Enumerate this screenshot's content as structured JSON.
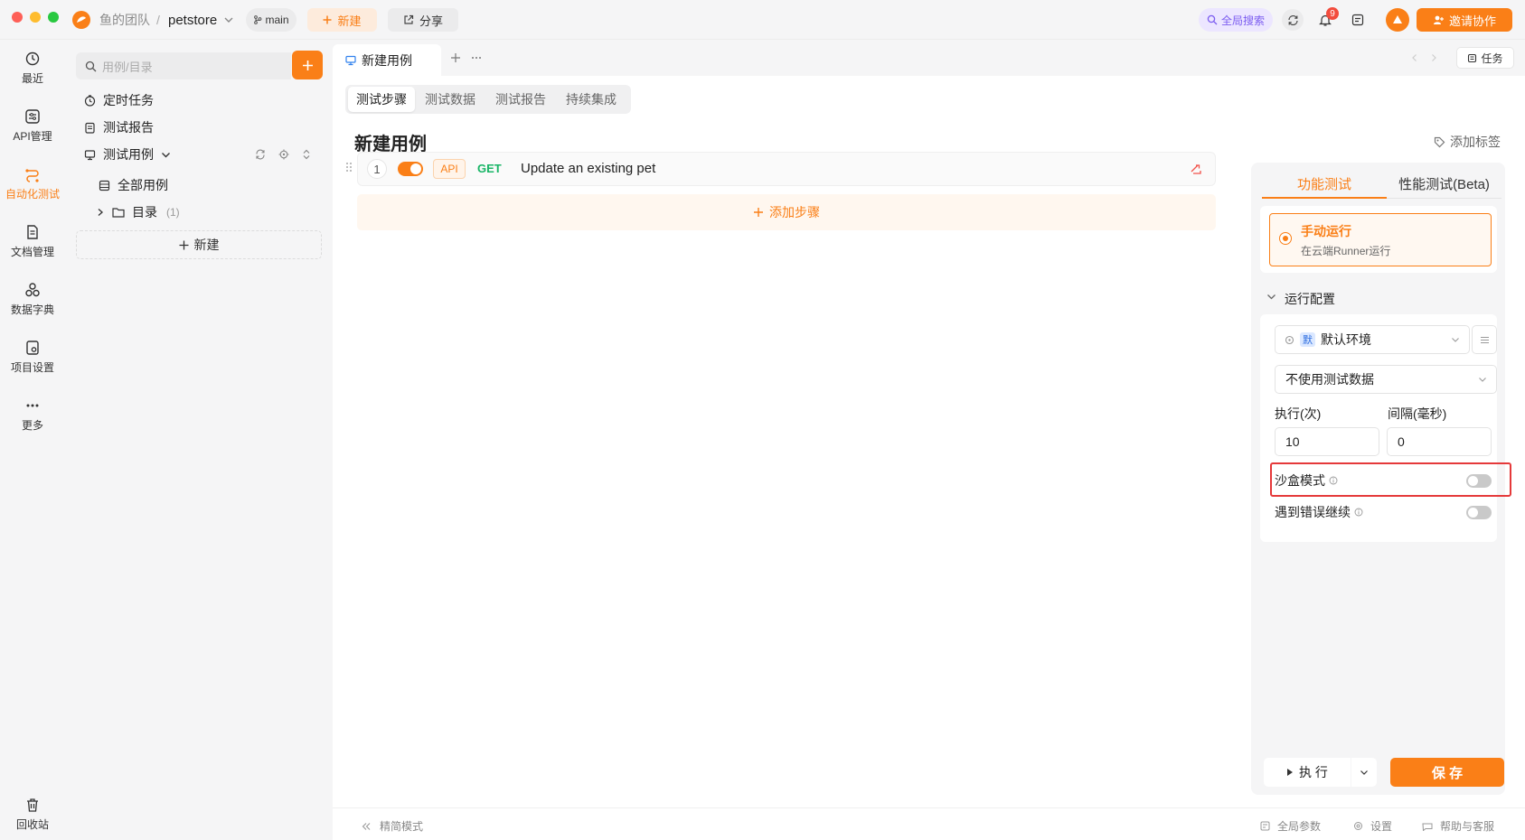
{
  "topbar": {
    "team": "鱼的团队",
    "separator": "/",
    "project": "petstore",
    "branch": "main",
    "new_label": "新建",
    "share_label": "分享",
    "search_label": "全局搜索",
    "notification_count": "9",
    "invite_label": "邀请协作"
  },
  "rail": {
    "items": [
      {
        "label": "最近",
        "icon": "history-icon"
      },
      {
        "label": "API管理",
        "icon": "api-icon"
      },
      {
        "label": "自动化测试",
        "icon": "automation-icon"
      },
      {
        "label": "文档管理",
        "icon": "document-icon"
      },
      {
        "label": "数据字典",
        "icon": "dictionary-icon"
      },
      {
        "label": "项目设置",
        "icon": "settings-icon"
      },
      {
        "label": "更多",
        "icon": "more-icon"
      }
    ],
    "trash": "回收站"
  },
  "tree": {
    "search_placeholder": "用例/目录",
    "items": [
      "定时任务",
      "测试报告",
      "测试用例",
      "全部用例",
      "目录"
    ],
    "folder_count": "(1)",
    "new_label": "新建"
  },
  "tabs": {
    "active_tab": "新建用例",
    "task_label": "任务"
  },
  "subtabs": [
    "测试步骤",
    "测试数据",
    "测试报告",
    "持续集成"
  ],
  "case": {
    "title": "新建用例",
    "add_tag": "添加标签",
    "step": {
      "index": "1",
      "type": "API",
      "method": "GET",
      "name": "Update an existing pet",
      "enabled": true
    },
    "add_step": "添加步骤"
  },
  "panel": {
    "tab_functional": "功能测试",
    "tab_performance": "性能测试(Beta)",
    "run_mode_title": "手动运行",
    "run_mode_sub": "在云端Runner运行",
    "config_title": "运行配置",
    "env_badge": "默",
    "env_name": "默认环境",
    "test_data": "不使用测试数据",
    "exec_label": "执行(次)",
    "exec_value": "10",
    "interval_label": "间隔(毫秒)",
    "interval_value": "0",
    "sandbox_label": "沙盒模式",
    "continue_label": "遇到错误继续",
    "run_button": "执 行",
    "save_button": "保 存"
  },
  "footer": {
    "compact": "精简模式",
    "global_params": "全局参数",
    "settings": "设置",
    "help": "帮助与客服"
  },
  "colors": {
    "accent": "#fa7f17",
    "get_method": "#18b566",
    "highlight": "#e5393a"
  }
}
